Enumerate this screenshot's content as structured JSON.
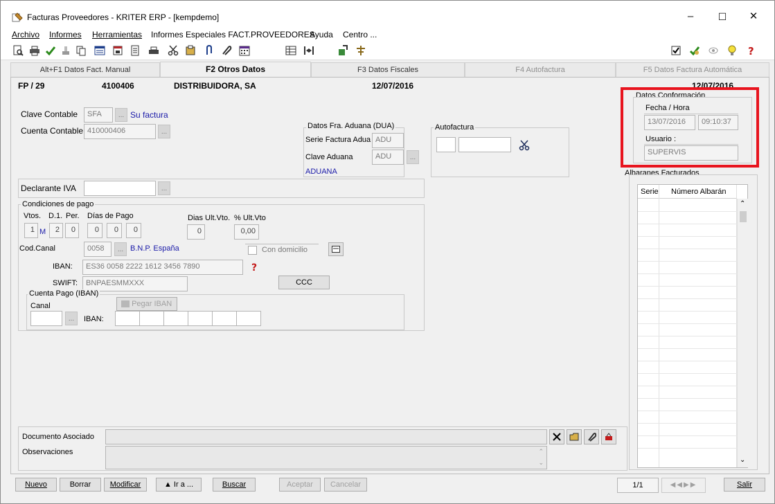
{
  "window": {
    "title": "Facturas Proveedores  - KRITER ERP - [kempdemo]",
    "minimize_glyph": "–",
    "maximize_glyph": "☐",
    "close_glyph": "✕"
  },
  "menu": {
    "archivo": "Archivo",
    "informes": "Informes",
    "herramientas": "Herramientas",
    "especiales": "Informes Especiales FACT.PROVEEDORES",
    "ayuda": "Ayuda",
    "centro": "Centro ..."
  },
  "tabs": [
    {
      "label": "Alt+F1 Datos Fact. Manual"
    },
    {
      "label": "F2 Otros Datos"
    },
    {
      "label": "F3 Datos Fiscales"
    },
    {
      "label": "F4 Autofactura"
    },
    {
      "label": "F5 Datos Factura Automática"
    }
  ],
  "header": {
    "code": "FP / 29",
    "account": "4100406",
    "name": "DISTRIBUIDORA, SA",
    "date": "12/07/2016",
    "date2": "12/07/2016"
  },
  "contable": {
    "clave_label": "Clave Contable",
    "clave_value": "SFA",
    "clave_link": "Su factura",
    "cuenta_label": "Cuenta Contable",
    "cuenta_value": "410000406"
  },
  "dua": {
    "title": "Datos Fra. Aduana (DUA)",
    "serie_label": "Serie Factura Adua",
    "serie_value": "ADU",
    "clave_label": "Clave Aduana",
    "clave_value": "ADU",
    "link": "ADUANA"
  },
  "autofactura": {
    "title": "Autofactura"
  },
  "conformacion": {
    "title": "Datos Conformación",
    "fecha_label": "Fecha / Hora",
    "fecha_value": "13/07/2016",
    "hora_value": "09:10:37",
    "usuario_label": "Usuario :",
    "usuario_value": "SUPERVIS"
  },
  "declarante": {
    "label": "Declarante IVA"
  },
  "pago": {
    "title": "Condiciones de pago",
    "vtos_label": "Vtos.",
    "d1_label": "D.1.",
    "per_label": "Per.",
    "dias_label": "Días de Pago",
    "vtos_value": "1",
    "vtos_unit": "M",
    "d1_value": "2",
    "per_value": "0",
    "dia1": "0",
    "dia2": "0",
    "dia3": "0",
    "ult_vto_label": "Dias Ult.Vto.",
    "ult_vto_value": "0",
    "pct_label": "% Ult.Vto",
    "pct_value": "0,00",
    "canal_label": "Cod.Canal",
    "canal_value": "0058",
    "canal_link": "B.N.P. España",
    "domicilio_label": "Con domicilio",
    "iban_label": "IBAN:",
    "iban_value": "ES36 0058 2222 1612 3456 7890",
    "swift_label": "SWIFT:",
    "swift_value": "BNPAESMMXXX",
    "ccc_button": "CCC",
    "cuenta_pago_title": "Cuenta Pago (IBAN)",
    "pegar_button": "Pegar IBAN",
    "canal2_label": "Canal",
    "iban2_label": "IBAN:"
  },
  "albaranes": {
    "title": "Albaranes Facturados",
    "col_serie": "Serie",
    "col_numero": "Número Albarán"
  },
  "documento": {
    "doc_label": "Documento Asociado",
    "obs_label": "Observaciones"
  },
  "buttons": {
    "nuevo": "Nuevo",
    "borrar": "Borrar",
    "modificar": "Modificar",
    "ira": "▲ Ir a ...",
    "buscar": "Buscar",
    "aceptar": "Aceptar",
    "cancelar": "Cancelar",
    "salir": "Salir"
  },
  "status": {
    "record": "1/1"
  },
  "colors": {
    "highlight": "#e8141e",
    "link": "#1a1aa8"
  }
}
